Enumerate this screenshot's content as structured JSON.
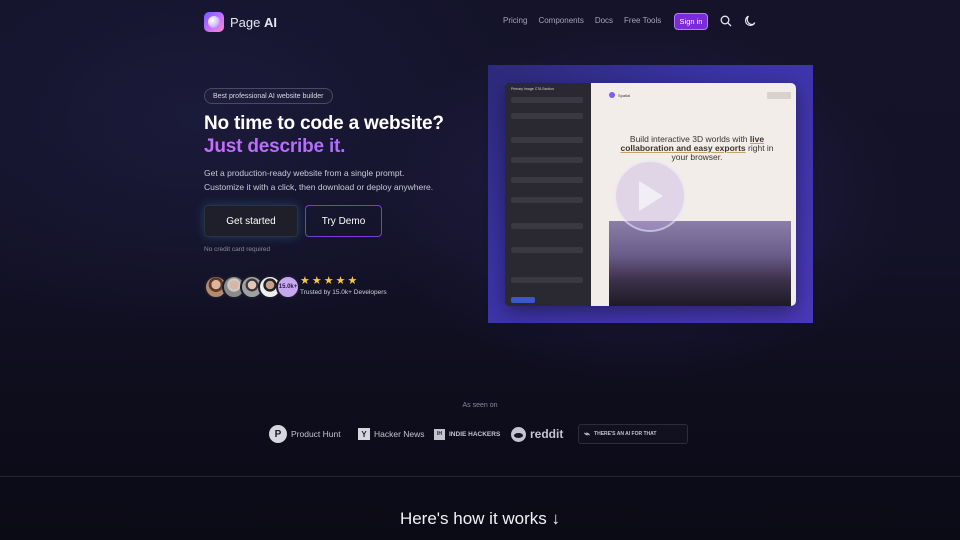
{
  "brand": {
    "name_light": "Page ",
    "name_bold": "AI"
  },
  "nav": {
    "links": [
      "Pricing",
      "Components",
      "Docs",
      "Free Tools"
    ],
    "signin": "Sign in"
  },
  "hero": {
    "badge": "Best professional AI website builder",
    "title_line1": "No time to code a website?",
    "title_line2": "Just describe it.",
    "subtitle_line1": "Get a production-ready website from a single prompt.",
    "subtitle_line2": "Customize it with a click, then download or deploy anywhere.",
    "cta_primary": "Get started",
    "cta_secondary": "Try Demo",
    "note": "No credit card required",
    "avatar_count": "15.0k+",
    "rating_stars": 5,
    "trusted": "Trusted by 15.0k+ Developers"
  },
  "video_preview": {
    "panel_header": "Primary Image CTA Section",
    "site_name": "Spatial",
    "headline_part1": "Build interactive 3D worlds with ",
    "headline_link": "live collaboration and easy exports",
    "headline_part2": " right in your browser."
  },
  "seen_on": {
    "label": "As seen on",
    "logos": [
      {
        "name": "Product Hunt",
        "icon": "product-hunt-icon"
      },
      {
        "name": "Hacker News",
        "icon": "hacker-news-icon"
      },
      {
        "name": "INDIE HACKERS",
        "icon": "indie-hackers-icon"
      },
      {
        "name": "reddit",
        "icon": "reddit-icon"
      },
      {
        "name": "THERE'S AN AI FOR THAT",
        "icon": "theresanai-icon"
      }
    ]
  },
  "how": {
    "title": "Here's how it works ↓"
  },
  "colors": {
    "accent": "#7c2bd9",
    "gradient_text": "#c86cff",
    "star": "#f5c84a"
  }
}
